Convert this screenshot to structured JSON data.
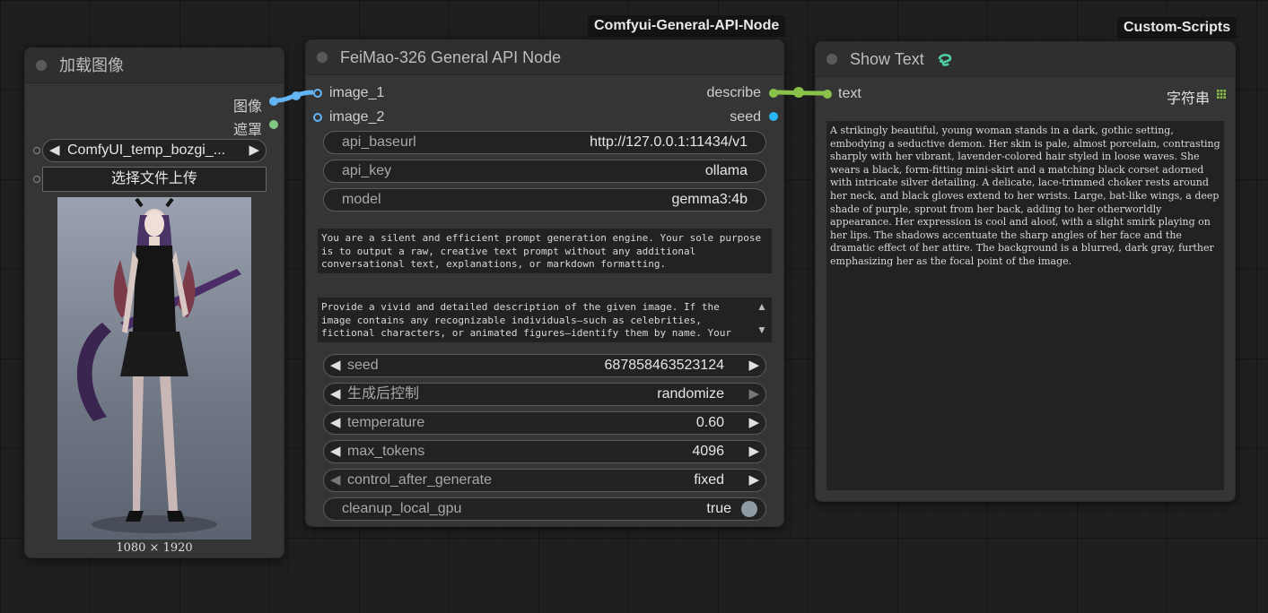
{
  "load_image_node": {
    "title": "加载图像",
    "outputs": [
      "图像",
      "遮罩"
    ],
    "image_combo": "ComfyUI_temp_bozgi_...",
    "upload_button": "选择文件上传",
    "image_size": "1080 × 1920"
  },
  "api_node": {
    "badge": "Comfyui-General-API-Node",
    "title": "FeiMao-326 General API Node",
    "inputs": [
      "image_1",
      "image_2"
    ],
    "outputs": [
      "describe",
      "seed"
    ],
    "api_baseurl": {
      "label": "api_baseurl",
      "value": "http://127.0.0.1:11434/v1"
    },
    "api_key": {
      "label": "api_key",
      "value": "ollama"
    },
    "model": {
      "label": "model",
      "value": "gemma3:4b"
    },
    "system_prompt": "You are a silent and efficient prompt generation engine. Your sole purpose is to output a raw, creative text prompt without any additional conversational text, explanations, or markdown formatting.",
    "user_prompt": "Provide a vivid and detailed description of the given image. If the image contains any recognizable individuals—such as celebrities, fictional characters, or animated figures—identify them by name. Your description should be specific and vivid.",
    "seed": {
      "label": "seed",
      "value": "687858463523124"
    },
    "generate_control": {
      "label": "生成后控制",
      "value": "randomize"
    },
    "temperature": {
      "label": "temperature",
      "value": "0.60"
    },
    "max_tokens": {
      "label": "max_tokens",
      "value": "4096"
    },
    "control_after_generate": {
      "label": "control_after_generate",
      "value": "fixed"
    },
    "cleanup_local_gpu": {
      "label": "cleanup_local_gpu",
      "value": "true"
    }
  },
  "show_text_node": {
    "badge": "Custom-Scripts",
    "title": "Show Text",
    "input": "text",
    "output_type": "字符串",
    "content": "A strikingly beautiful, young woman stands in a dark, gothic setting, embodying a seductive demon. Her skin is pale, almost porcelain, contrasting sharply with her vibrant, lavender-colored hair styled in loose waves. She wears a black, form-fitting mini-skirt and a matching black corset adorned with intricate silver detailing. A delicate, lace-trimmed choker rests around her neck, and black gloves extend to her wrists. Large, bat-like wings, a deep shade of purple, sprout from her back, adding to her otherworldly appearance. Her expression is cool and aloof, with a slight smirk playing on her lips. The shadows accentuate the sharp angles of her face and the dramatic effect of her attire. The background is a blurred, dark gray, further emphasizing her as the focal point of the image."
  },
  "colors": {
    "image_link": "#64b5f6",
    "mask_link": "#81c784",
    "string_link": "#8bc34a",
    "int_link": "#29b6f6"
  }
}
